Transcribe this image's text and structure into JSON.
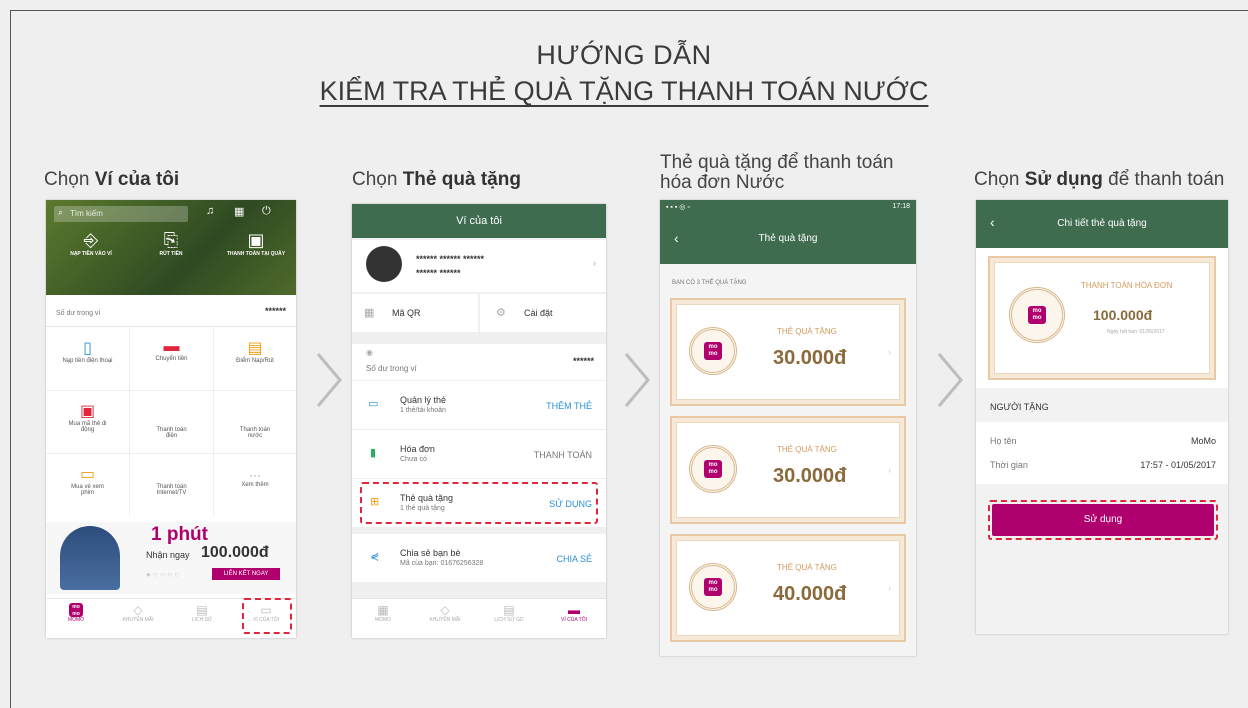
{
  "title": {
    "line1": "HƯỚNG DẪN",
    "line2": "KIỂM TRA THẺ QUÀ TẶNG THANH TOÁN NƯỚC"
  },
  "steps": [
    {
      "pre": "Chọn ",
      "bold": "Ví của tôi",
      "post": ""
    },
    {
      "pre": "Chọn ",
      "bold": "Thẻ quà tặng",
      "post": ""
    },
    {
      "pre": "Thẻ quà tặng để thanh toán hóa đơn Nước",
      "bold": "",
      "post": ""
    },
    {
      "pre": "Chọn ",
      "bold": "Sử dụng",
      "post": " để thanh toán"
    }
  ],
  "phone1": {
    "search_placeholder": "Tìm kiếm",
    "top_actions": [
      "NẠP TIỀN VÀO VÍ",
      "RÚT TIỀN",
      "THANH TOÁN TẠI QUẦY"
    ],
    "balance_label": "Số dư trong ví",
    "balance_value": "******",
    "grid": [
      "Nạp tiền điện thoại",
      "Chuyển tiền",
      "Điểm Nạp/Rút",
      "Mua mã thẻ di động",
      "Thanh toán điện",
      "Thanh toán nước",
      "Mua vé xem phim",
      "Thanh toán Internet/TV",
      "Xem thêm"
    ],
    "promo_big": "1 phút",
    "promo_small": "Nhận ngay",
    "promo_amount": "100.000đ",
    "promo_button": "LIÊN KẾT NGAY",
    "nav": [
      "MOMO",
      "KHUYẾN MÃI",
      "LỊCH SỬ",
      "VÍ CỦA TÔI"
    ]
  },
  "phone2": {
    "header": "Ví của tôi",
    "name_masked": "****** ****** ******",
    "phone_masked": "****** ******",
    "qr_label": "Mã QR",
    "settings_label": "Cài đặt",
    "balance_label": "Số dư trong ví",
    "balance_value": "******",
    "rows": [
      {
        "title": "Quản lý thẻ",
        "sub": "1 thẻ/tài khoản",
        "action": "THÊM THẺ",
        "accent": "#2a8fd6"
      },
      {
        "title": "Hóa đơn",
        "sub": "Chưa có",
        "action": "THANH TOÁN",
        "accent": "#777777"
      },
      {
        "title": "Thẻ quà tặng",
        "sub": "1 thẻ quà tặng",
        "action": "SỬ DỤNG",
        "accent": "#2a8fd6"
      },
      {
        "title": "Chia sẻ bạn bè",
        "sub": "Mã của bạn: 01676256328",
        "action": "CHIA SẺ",
        "accent": "#2a8fd6"
      }
    ],
    "nav": [
      "MOMO",
      "KHUYẾN MÃI",
      "LỊCH SỬ GD",
      "VÍ CỦA TÔI"
    ]
  },
  "phone3": {
    "status_time": "17:18",
    "header": "Thẻ quà tặng",
    "count_label": "BẠN CÓ 3 THẺ QUÀ TẶNG",
    "cards": [
      {
        "label": "THẺ QUÀ TẶNG",
        "amount": "30.000đ"
      },
      {
        "label": "THẺ QUÀ TẶNG",
        "amount": "30.000đ"
      },
      {
        "label": "THẺ QUÀ TẶNG",
        "amount": "40.000đ"
      }
    ]
  },
  "phone4": {
    "header": "Chi tiết thẻ quà tặng",
    "card_title": "THANH TOÁN HÓA ĐƠN",
    "card_amount": "100.000đ",
    "card_expiry": "Ngày hết hạn: 01/05/2017",
    "section": "NGƯỜI TẶNG",
    "name_label": "Họ tên",
    "name_value": "MoMo",
    "time_label": "Thời gian",
    "time_value": "17:57 - 01/05/2017",
    "button": "Sử dụng"
  },
  "colors": {
    "header_green": "#3f6b4f",
    "momo_pink": "#b0006e",
    "dash_red": "#e0263a",
    "gift_gold": "#d49b5b"
  },
  "logo_text": "mo mo"
}
